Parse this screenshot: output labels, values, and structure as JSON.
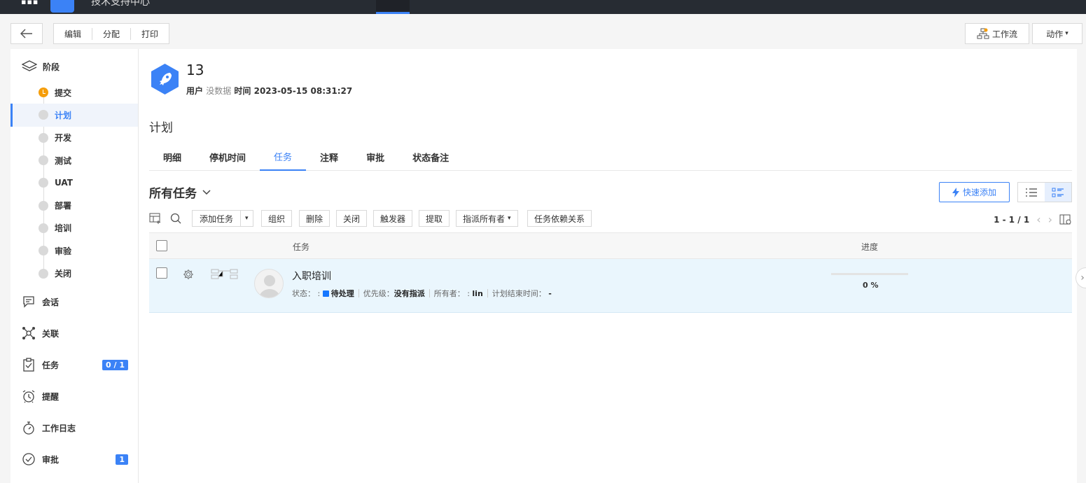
{
  "header": {
    "app_title": "技术支持中心"
  },
  "toolbar": {
    "back_label": "←",
    "edit_label": "编辑",
    "assign_label": "分配",
    "print_label": "打印",
    "workflow_label": "工作流",
    "action_label": "动作"
  },
  "sidebar": {
    "stage_heading": "阶段",
    "stages": [
      "提交",
      "计划",
      "开发",
      "测试",
      "UAT",
      "部署",
      "培训",
      "审验",
      "关闭"
    ],
    "nav": {
      "conversation": "会话",
      "relations": "关联",
      "tasks": "任务",
      "tasks_badge": "0 / 1",
      "reminders": "提醒",
      "worklog": "工作日志",
      "approvals": "审批",
      "approvals_badge": "1"
    }
  },
  "record": {
    "number": "13",
    "user_label": "用户",
    "user_value": "没数据",
    "time_label": "时间",
    "time_value": "2023-05-15 08:31:27",
    "section_title": "计划"
  },
  "tabs": [
    "明细",
    "停机时间",
    "任务",
    "注释",
    "审批",
    "状态备注"
  ],
  "task_list": {
    "title": "所有任务",
    "quick_add": "快速添加",
    "buttons": {
      "add_task": "添加任务",
      "organize": "组织",
      "delete": "删除",
      "close": "关闭",
      "trigger": "触发器",
      "extract": "提取",
      "assign_owner": "指派所有者",
      "dependency": "任务依赖关系"
    },
    "pager": "1 - 1 / 1",
    "columns": {
      "task": "任务",
      "progress": "进度"
    },
    "rows": [
      {
        "name": "入职培训",
        "status_label": "状态：",
        "status_value": "待处理",
        "priority_label": "优先级：",
        "priority_value": "没有指派",
        "owner_label": "所有者：",
        "owner_value": "lin",
        "due_label": "计划结束时间：",
        "due_value": "-",
        "progress_text": "0 %",
        "progress": 0
      }
    ]
  },
  "colors": {
    "accent": "#3b82f6",
    "stage_done": "#f59e0b",
    "status_pending": "#1677ff"
  }
}
